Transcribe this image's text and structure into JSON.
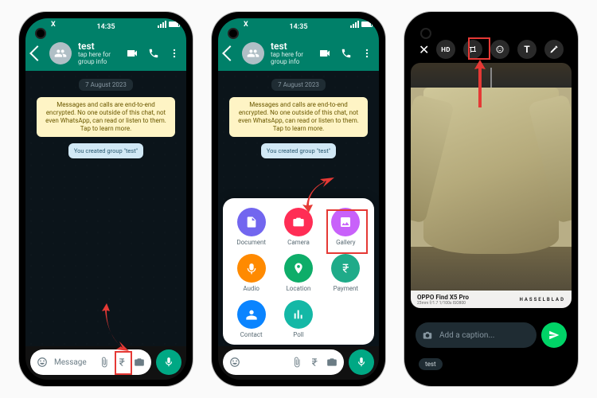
{
  "status": {
    "time": "14:35",
    "carrier_icon": "x-icon",
    "battery_pct": 90
  },
  "chat": {
    "title": "test",
    "subtitle": "tap here for group info",
    "date": "7 August 2023",
    "encryption_notice": "Messages and calls are end-to-end encrypted. No one outside of this chat, not even WhatsApp, can read or listen to them. Tap to learn more.",
    "system_message": "You created group \"test\"",
    "input_placeholder": "Message"
  },
  "attach": {
    "document": "Document",
    "camera": "Camera",
    "gallery": "Gallery",
    "audio": "Audio",
    "location": "Location",
    "payment": "Payment",
    "contact": "Contact",
    "poll": "Poll"
  },
  "editor": {
    "caption_placeholder": "Add a caption...",
    "recipient": "test",
    "watermark_model": "OPPO Find X5 Pro",
    "watermark_meta": "23mm f/1.7 1/100s ISO800",
    "watermark_brand": "HASSELBLAD"
  }
}
